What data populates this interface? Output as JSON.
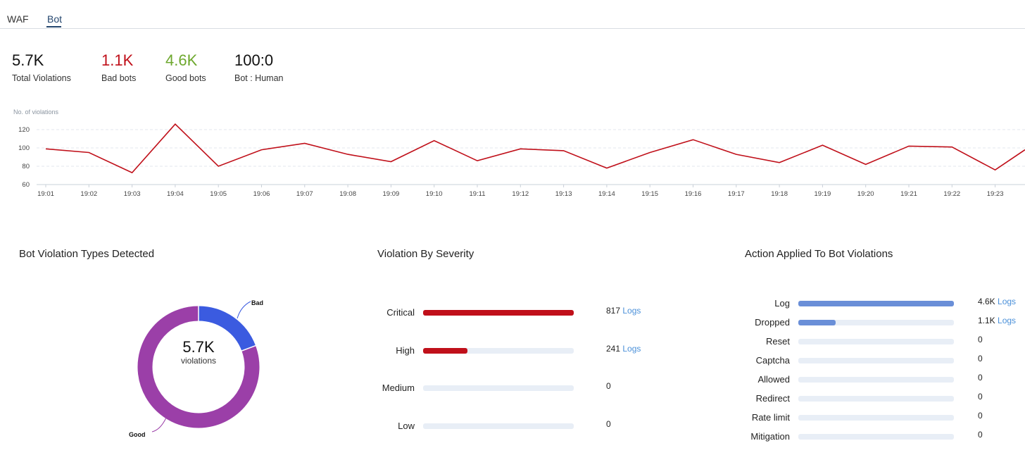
{
  "tabs": [
    {
      "label": "WAF",
      "active": false
    },
    {
      "label": "Bot",
      "active": true
    }
  ],
  "stats": [
    {
      "value": "5.7K",
      "label": "Total Violations",
      "color": "#111111"
    },
    {
      "value": "1.1K",
      "label": "Bad bots",
      "color": "#c0101a"
    },
    {
      "value": "4.6K",
      "label": "Good bots",
      "color": "#6ea82e"
    },
    {
      "value": "100:0",
      "label": "Bot : Human",
      "color": "#111111"
    }
  ],
  "chart_data": [
    {
      "type": "line",
      "ylabel": "No. of violations",
      "ylim": [
        60,
        130
      ],
      "yticks": [
        60,
        80,
        100,
        120
      ],
      "grid": true,
      "color": "#c0101a",
      "x": [
        "19:01",
        "19:02",
        "19:03",
        "19:04",
        "19:05",
        "19:06",
        "19:07",
        "19:08",
        "19:09",
        "19:10",
        "19:11",
        "19:12",
        "19:13",
        "19:14",
        "19:15",
        "19:16",
        "19:17",
        "19:18",
        "19:19",
        "19:20",
        "19:21",
        "19:22",
        "19:23"
      ],
      "values": [
        99,
        95,
        73,
        126,
        80,
        98,
        105,
        93,
        85,
        108,
        86,
        99,
        97,
        78,
        95,
        109,
        93,
        84,
        103,
        82,
        102,
        101,
        76
      ],
      "trailing_value": 98
    },
    {
      "type": "pie",
      "title": "Bot Violation Types Detected",
      "center_value": "5.7K",
      "center_label": "violations",
      "slices": [
        {
          "name": "Bad",
          "value": 1.1,
          "color": "#3b5be0"
        },
        {
          "name": "Good",
          "value": 4.6,
          "color": "#9b3fa8"
        }
      ]
    },
    {
      "type": "bar",
      "title": "Violation By Severity",
      "color": "#c0101a",
      "categories": [
        "Critical",
        "High",
        "Medium",
        "Low"
      ],
      "values": [
        817,
        241,
        0,
        0
      ],
      "display": [
        "817",
        "241",
        "0",
        "0"
      ],
      "logs": [
        true,
        true,
        false,
        false
      ]
    },
    {
      "type": "bar",
      "title": "Action Applied To Bot Violations",
      "color": "#6a8fd8",
      "categories": [
        "Log",
        "Dropped",
        "Reset",
        "Captcha",
        "Allowed",
        "Redirect",
        "Rate limit",
        "Mitigation"
      ],
      "values": [
        4600,
        1100,
        0,
        0,
        0,
        0,
        0,
        0
      ],
      "display": [
        "4.6K",
        "1.1K",
        "0",
        "0",
        "0",
        "0",
        "0",
        "0"
      ],
      "logs": [
        true,
        true,
        false,
        false,
        false,
        false,
        false,
        false
      ]
    }
  ],
  "logs_label": "Logs",
  "track_color": "#e8eef6"
}
